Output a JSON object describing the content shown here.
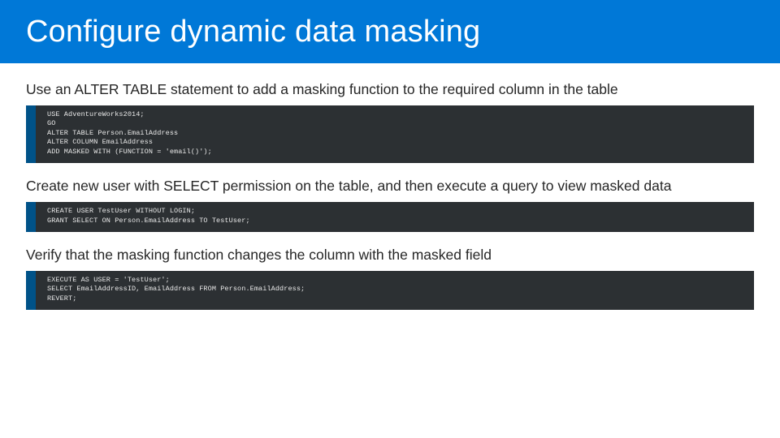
{
  "header": {
    "title": "Configure dynamic data masking"
  },
  "steps": [
    {
      "text": "Use an ALTER TABLE statement to add a masking function to the required column in the table",
      "code": "USE AdventureWorks2014;\nGO\nALTER TABLE Person.EmailAddress\nALTER COLUMN EmailAddress\nADD MASKED WITH (FUNCTION = 'email()');"
    },
    {
      "text": "Create new user with SELECT permission on the table, and then execute a query to view masked data",
      "code": "CREATE USER TestUser WITHOUT LOGIN;\nGRANT SELECT ON Person.EmailAddress TO TestUser;"
    },
    {
      "text": "Verify that the masking function changes the column with the masked field",
      "code": "EXECUTE AS USER = 'TestUser';\nSELECT EmailAddressID, EmailAddress FROM Person.EmailAddress;\nREVERT;"
    }
  ]
}
